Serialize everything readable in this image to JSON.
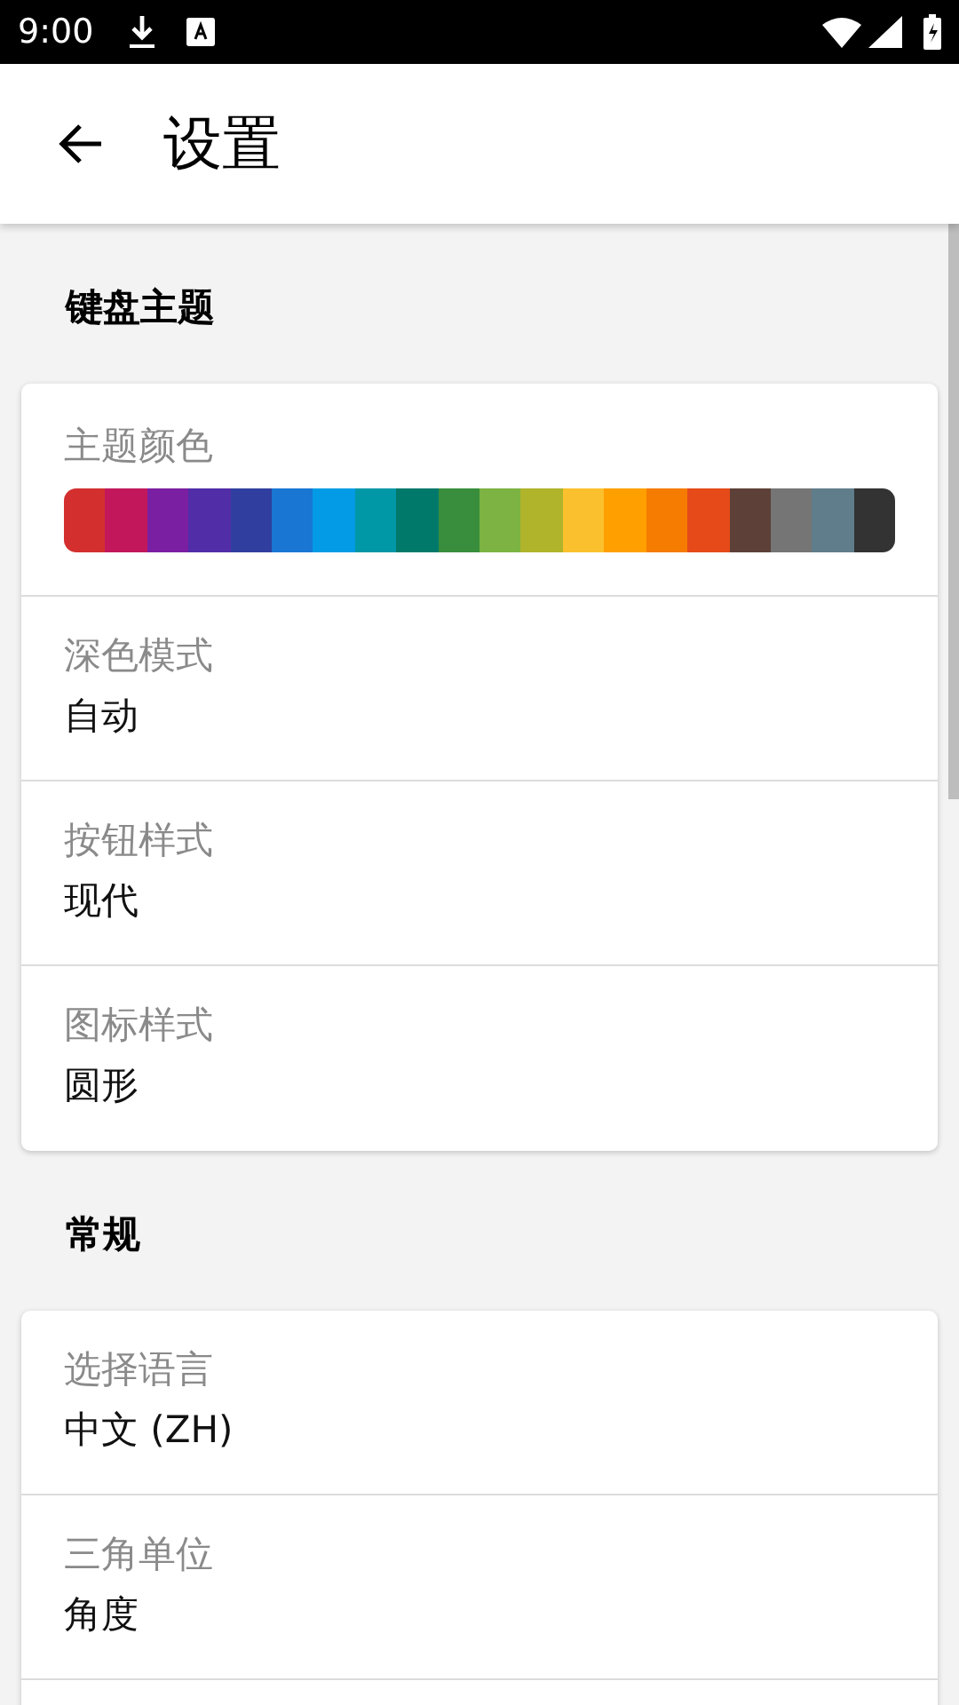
{
  "status_bar": {
    "time": "9:00"
  },
  "app_bar": {
    "title": "设置"
  },
  "sections": [
    {
      "title": "键盘主题",
      "items": [
        {
          "kind": "colors",
          "label": "主题颜色",
          "swatches": [
            {
              "color": "#d32f2f"
            },
            {
              "color": "#c2185b"
            },
            {
              "color": "#7b1fa2"
            },
            {
              "color": "#512da8"
            },
            {
              "color": "#303f9f"
            },
            {
              "color": "#1976d2"
            },
            {
              "color": "#039be5"
            },
            {
              "color": "#0097a7"
            },
            {
              "color": "#00796b"
            },
            {
              "color": "#388e3c"
            },
            {
              "color": "#7cb342"
            },
            {
              "color": "#afb42b"
            },
            {
              "color": "#fbc02d"
            },
            {
              "color": "#ffa000"
            },
            {
              "color": "#f57c00"
            },
            {
              "color": "#e64a19"
            },
            {
              "color": "#5d4037"
            },
            {
              "color": "#757575"
            },
            {
              "color": "#607d8b"
            },
            {
              "color": "#333333"
            }
          ]
        },
        {
          "kind": "value",
          "label": "深色模式",
          "value": "自动"
        },
        {
          "kind": "value",
          "label": "按钮样式",
          "value": "现代"
        },
        {
          "kind": "value",
          "label": "图标样式",
          "value": "圆形"
        }
      ]
    },
    {
      "title": "常规",
      "items": [
        {
          "kind": "value",
          "label": "选择语言",
          "value": "中文 (ZH)"
        },
        {
          "kind": "value",
          "label": "三角单位",
          "value": "角度"
        },
        {
          "kind": "value"
        }
      ]
    }
  ]
}
